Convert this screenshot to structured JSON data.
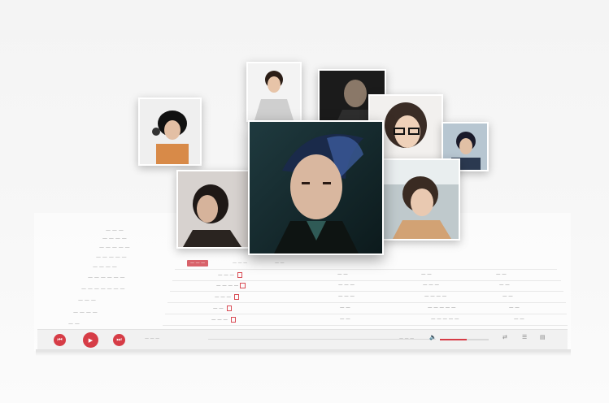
{
  "colors": {
    "accent": "#d63c46",
    "background": "#f5f5f5"
  },
  "photos": [
    {
      "name": "singer-photo-1",
      "desc_icon": "photo-icon"
    },
    {
      "name": "singer-photo-2",
      "desc_icon": "photo-icon"
    },
    {
      "name": "singer-photo-3",
      "desc_icon": "photo-icon"
    },
    {
      "name": "singer-photo-4",
      "desc_icon": "photo-icon"
    },
    {
      "name": "singer-photo-5",
      "desc_icon": "photo-icon"
    },
    {
      "name": "singer-photo-6",
      "desc_icon": "photo-icon"
    },
    {
      "name": "singer-photo-7",
      "desc_icon": "photo-icon"
    },
    {
      "name": "singer-photo-featured",
      "desc_icon": "photo-icon"
    }
  ],
  "sidebar": {
    "items": [
      "— — —",
      "— — — —",
      "— — — — —",
      "— — — — —",
      "— — — —",
      "— — — — — —",
      "— — — — — — —",
      "— — —",
      "— — — —",
      "— —"
    ]
  },
  "tabs": [
    {
      "label": "— — —",
      "active": true
    },
    {
      "label": "— — —",
      "active": false
    },
    {
      "label": "— —",
      "active": false
    }
  ],
  "controls": {
    "prev_icon": "previous-icon",
    "play_icon": "play-icon",
    "next_icon": "next-icon",
    "volume_icon": "volume-icon",
    "volume_level": 0.55,
    "shuffle_icon": "shuffle-icon",
    "lyrics_icon": "lyrics-icon",
    "playlist_icon": "playlist-icon"
  }
}
